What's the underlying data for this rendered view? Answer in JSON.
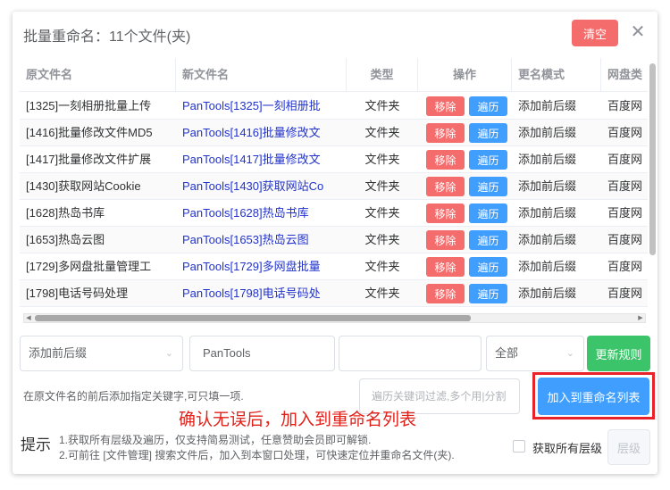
{
  "dialog": {
    "title": "批量重命名：11个文件(夹)",
    "clear_label": "清空",
    "close_icon": "close-icon"
  },
  "table": {
    "headers": [
      "原文件名",
      "新文件名",
      "类型",
      "操作",
      "更名模式",
      "网盘类"
    ],
    "rows": [
      {
        "orig": "[1325]一刻相册批量上传",
        "new": "PanTools[1325]一刻相册批",
        "type": "文件夹",
        "remove": "移除",
        "traverse": "遍历",
        "mode": "添加前后缀",
        "disk": "百度网"
      },
      {
        "orig": "[1416]批量修改文件MD5",
        "new": "PanTools[1416]批量修改文",
        "type": "文件夹",
        "remove": "移除",
        "traverse": "遍历",
        "mode": "添加前后缀",
        "disk": "百度网"
      },
      {
        "orig": "[1417]批量修改文件扩展",
        "new": "PanTools[1417]批量修改文",
        "type": "文件夹",
        "remove": "移除",
        "traverse": "遍历",
        "mode": "添加前后缀",
        "disk": "百度网"
      },
      {
        "orig": "[1430]获取网站Cookie",
        "new": "PanTools[1430]获取网站Co",
        "type": "文件夹",
        "remove": "移除",
        "traverse": "遍历",
        "mode": "添加前后缀",
        "disk": "百度网"
      },
      {
        "orig": "[1628]热岛书库",
        "new": "PanTools[1628]热岛书库",
        "type": "文件夹",
        "remove": "移除",
        "traverse": "遍历",
        "mode": "添加前后缀",
        "disk": "百度网"
      },
      {
        "orig": "[1653]热岛云图",
        "new": "PanTools[1653]热岛云图",
        "type": "文件夹",
        "remove": "移除",
        "traverse": "遍历",
        "mode": "添加前后缀",
        "disk": "百度网"
      },
      {
        "orig": "[1729]多网盘批量管理工",
        "new": "PanTools[1729]多网盘批量",
        "type": "文件夹",
        "remove": "移除",
        "traverse": "遍历",
        "mode": "添加前后缀",
        "disk": "百度网"
      },
      {
        "orig": "[1798]电话号码处理",
        "new": "PanTools[1798]电话号码处",
        "type": "文件夹",
        "remove": "移除",
        "traverse": "遍历",
        "mode": "添加前后缀",
        "disk": "百度网"
      }
    ]
  },
  "form": {
    "mode_select": "添加前后缀",
    "prefix_value": "PanTools",
    "suffix_value": "",
    "scope_select": "全部",
    "update_label": "更新规则",
    "hint": "在原文件名的前后添加指定关键字,可只填一项.",
    "filter_placeholder": "遍历关键词过滤,多个用|分割",
    "add_label": "加入到重命名列表",
    "annotation": "确认无误后，加入到重命名列表"
  },
  "tips": {
    "label": "提示",
    "line1": "1.获取所有层级及遍历，仅支持简易测试，任意赞助会员即可解锁.",
    "line2": "2.可前往 [文件管理] 搜索文件后，加入到本窗口处理，可快速定位并重命名文件(夹).",
    "checkbox_label": "获取所有层级",
    "level_label": "层级"
  },
  "colors": {
    "danger": "#f56c6c",
    "primary": "#409eff",
    "success": "#3cc46a",
    "annotation": "#e0221b"
  }
}
